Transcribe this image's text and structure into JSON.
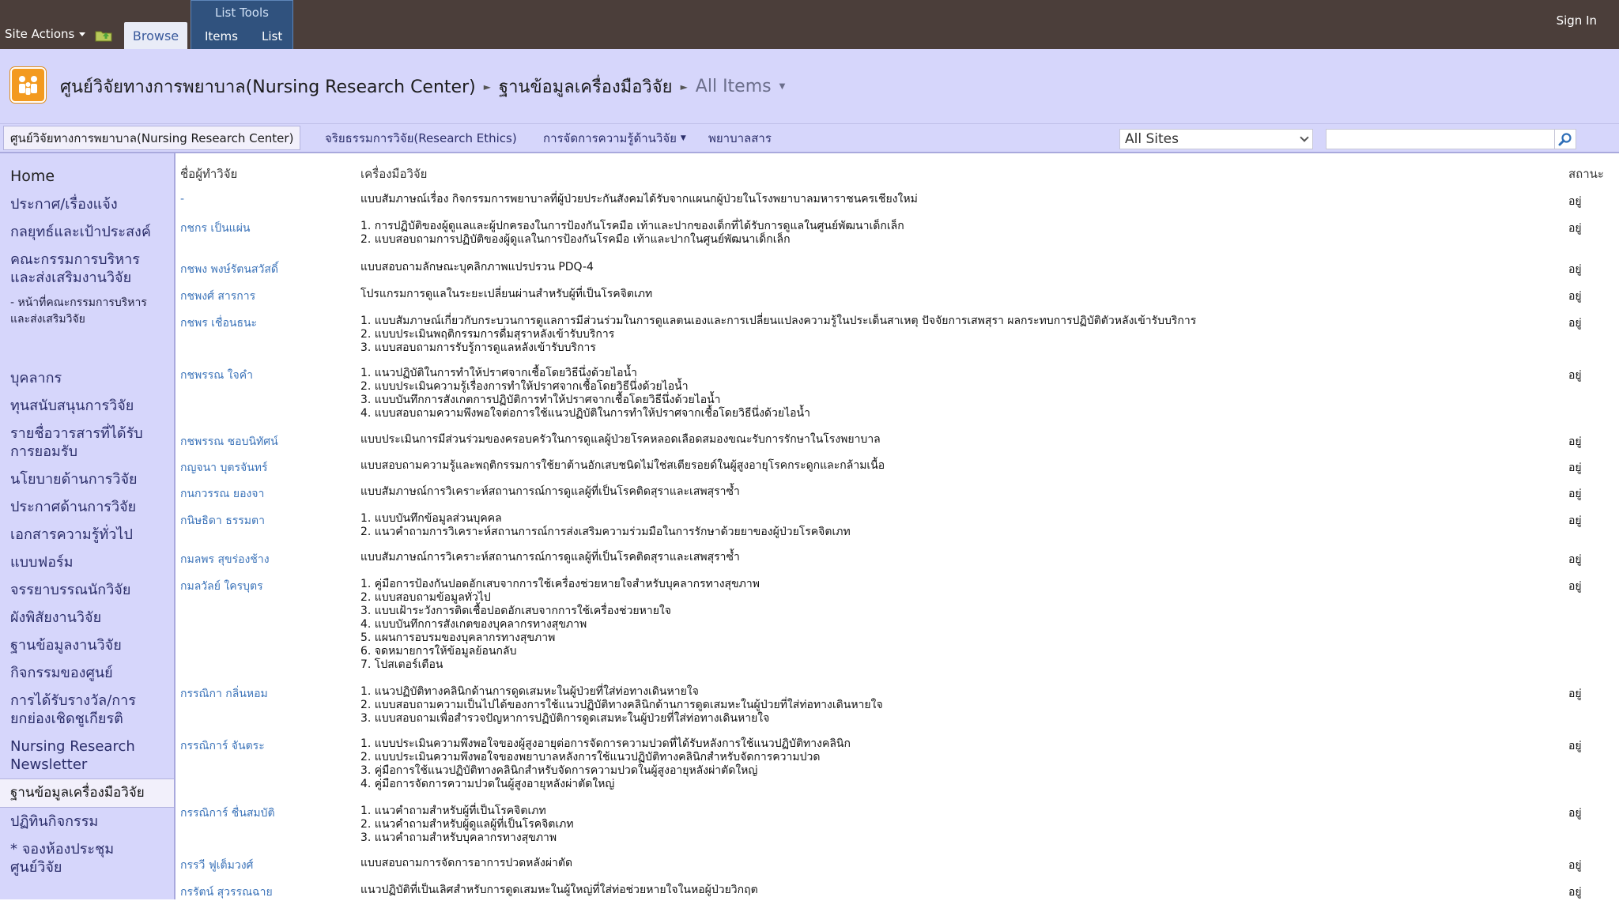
{
  "ribbon": {
    "site_actions": "Site Actions",
    "browse_tab": "Browse",
    "list_tools": "List Tools",
    "items_tab": "Items",
    "list_tab": "List",
    "sign_in": "Sign In"
  },
  "title": {
    "site": "ศูนย์วิจัยทางการพยาบาล(Nursing Research Center)",
    "list": "ฐานข้อมูลเครื่องมือวิจัย",
    "view": "All Items"
  },
  "topnav": {
    "items": [
      "ศูนย์วิจัยทางการพยาบาล(Nursing Research Center)",
      "จริยธรรมการวิจัย(Research Ethics)",
      "การจัดการความรู้ด้านวิจัย",
      "พยาบาลสาร"
    ],
    "scope": "All Sites"
  },
  "leftnav": {
    "items": [
      "Home",
      "ประกาศ/เรื่องแจ้ง",
      "กลยุทธ์และเป้าประสงค์",
      "คณะกรรมการบริหารและส่งเสริมงานวิจัย",
      "- หน้าที่คณะกรรมการบริหารและส่งเสริมวิจัย",
      "บุคลากร",
      "ทุนสนับสนุนการวิจัย",
      "รายชื่อวารสารที่ได้รับการยอมรับ",
      "นโยบายด้านการวิจัย",
      "ประกาศด้านการวิจัย",
      "เอกสารความรู้ทั่วไป",
      "แบบฟอร์ม",
      "จรรยาบรรณนักวิจัย",
      "ผังพิสัยงานวิจัย",
      "ฐานข้อมูลงานวิจัย",
      "กิจกรรมของศูนย์",
      "การได้รับรางวัล/การยกย่องเชิดชูเกียรติ",
      "Nursing Research Newsletter",
      "ฐานข้อมูลเครื่องมือวิจัย",
      "ปฏิทินกิจกรรม",
      "* จองห้องประชุมศูนย์วิจัย"
    ]
  },
  "table": {
    "headers": [
      "ชื่อผู้ทำวิจัย",
      "เครื่องมือวิจัย",
      "สถานะ"
    ],
    "rows": [
      {
        "name": "-",
        "tools": [
          "แบบสัมภาษณ์เรื่อง กิจกรรมการพยาบาลที่ผู้ป่วยประกันสังคมได้รับจากแผนกผู้ป่วยในโรงพยาบาลมหาราชนครเชียงใหม่"
        ],
        "status": "อยู่"
      },
      {
        "name": "กชกร เป็นแผ่น",
        "tools": [
          "1. การปฏิบัติของผู้ดูแลและผู้ปกครองในการป้องกันโรคมือ เท้าและปากของเด็กที่ได้รับการดูแลในศูนย์พัฒนาเด็กเล็ก",
          "2. แบบสอบถามการปฏิบัติของผู้ดูแลในการป้องกันโรคมือ เท้าและปากในศูนย์พัฒนาเด็กเล็ก"
        ],
        "status": "อยู่"
      },
      {
        "name": "กชพง พงษ์รัตนสวัสดิ์",
        "tools": [
          " แบบสอบถามลักษณะบุคลิกภาพแปรปรวน PDQ-4"
        ],
        "status": "อยู่"
      },
      {
        "name": "กชพงศ์ สารการ",
        "tools": [
          "โปรแกรมการดูแลในระยะเปลี่ยนผ่านสำหรับผู้ที่เป็นโรคจิตเภท"
        ],
        "status": "อยู่"
      },
      {
        "name": "กชพร เชื่อนธนะ",
        "tools": [
          "1. แบบสัมภาษณ์เกี่ยวกับกระบวนการดูแลการมีส่วนร่วมในการดูแลตนเองและการเปลี่ยนแปลงความรู้ในประเด็นสาเหตุ ปัจจัยการเสพสุรา ผลกระทบการปฏิบัติตัวหลังเข้ารับบริการ",
          "2. แบบประเมินพฤติกรรมการดื่มสุราหลังเข้ารับบริการ",
          "3. แบบสอบถามการรับรู้การดูแลหลังเข้ารับบริการ"
        ],
        "status": "อยู่"
      },
      {
        "name": "กชพรรณ ใจคำ",
        "tools": [
          "1. แนวปฏิบัติในการทำให้ปราศจากเชื้อโดยวิธีนึ่งด้วยไอน้ำ",
          "2. แบบประเมินความรู้เรื่องการทำให้ปราศจากเชื้อโดยวิธีนึ่งด้วยไอน้ำ",
          "3. แบบบันทึกการสังเกตการปฏิบัติการทำให้ปราศจากเชื้อโดยวิธีนึ่งด้วยไอน้ำ",
          "4. แบบสอบถามความพึงพอใจต่อการใช้แนวปฏิบัติในการทำให้ปราศจากเชื้อโดยวิธีนึ่งด้วยไอน้ำ"
        ],
        "status": "อยู่"
      },
      {
        "name": "กชพรรณ ชอบนิทัศน์",
        "tools": [
          "แบบประเมินการมีส่วนร่วมของครอบครัวในการดูแลผู้ป่วยโรคหลอดเลือดสมองขณะรับการรักษาในโรงพยาบาล"
        ],
        "status": "อยู่"
      },
      {
        "name": "กญจนา บุตรจันทร์",
        "tools": [
          "แบบสอบถามความรู้และพฤติกรรมการใช้ยาต้านอักเสบชนิดไม่ใช่สเตียรอยด์ในผู้สูงอายุโรคกระดูกและกล้ามเนื้อ"
        ],
        "status": "อยู่"
      },
      {
        "name": "กนกวรรณ ยองจา",
        "tools": [
          "แบบสัมภาษณ์การวิเคราะห์สถานการณ์การดูแลผู้ที่เป็นโรคติดสุราและเสพสุราซ้ำ"
        ],
        "status": "อยู่"
      },
      {
        "name": "กนิษธิดา ธรรมตา",
        "tools": [
          "1. แบบบันทึกข้อมูลส่วนบุคคล",
          "2. แนวคำถามการวิเคราะห์สถานการณ์การส่งเสริมความร่วมมือในการรักษาด้วยยาของผู้ป่วยโรคจิตเภท"
        ],
        "status": "อยู่"
      },
      {
        "name": "กมลพร สุขร่องช้าง",
        "tools": [
          "แบบสัมภาษณ์การวิเคราะห์สถานการณ์การดูแลผู้ที่เป็นโรคติดสุราและเสพสุราซ้ำ"
        ],
        "status": "อยู่"
      },
      {
        "name": "กมลวัลย์ ใครบุตร",
        "tools": [
          "1. คู่มือการป้องกันปอดอักเสบจากการใช้เครื่องช่วยหายใจสำหรับบุคลากรทางสุขภาพ",
          "2. แบบสอบถามข้อมูลทั่วไป",
          "3. แบบเฝ้าระวังการติดเชื้อปอดอักเสบจากการใช้เครื่องช่วยหายใจ",
          "4. แบบบันทึกการสังเกตของบุคลากรทางสุขภาพ",
          "5. แผนการอบรมของบุคลากรทางสุขภาพ",
          "6. จดหมายการให้ข้อมูลย้อนกลับ",
          "7. โปสเตอร์เตือน"
        ],
        "status": "อยู่"
      },
      {
        "name": "กรรณิกา กลิ่นหอม",
        "tools": [
          "1.  แนวปฏิบัติทางคลินิกด้านการดูดเสมหะในผู้ป่วยที่ใส่ท่อทางเดินหายใจ",
          "2.  แบบสอบถามความเป็นไปได้ของการใช้แนวปฏิบัติทางคลินิกด้านการดูดเสมหะในผู้ป่วยที่ใส่ท่อทางเดินหายใจ",
          "3.  แบบสอบถามเพื่อสำรวจปัญหาการปฏิบัติการดูดเสมหะในผู้ป่วยที่ใส่ท่อทางเดินหายใจ"
        ],
        "status": "อยู่"
      },
      {
        "name": "กรรณิการ์ จันตระ",
        "tools": [
          "1. แบบประเมินความพึงพอใจของผู้สูงอายุต่อการจัดการความปวดที่ได้รับหลังการใช้แนวปฏิบัติทางคลินิก",
          "2. แบบประเมินความพึงพอใจของพยาบาลหลังการใช้แนวปฏิบัติทางคลินิกสำหรับจัดการความปวด",
          "3. คู่มือการใช้แนวปฏิบัติทางคลินิกสำหรับจัดการความปวดในผู้สูงอายุหลังผ่าตัดใหญ่",
          "4. คู่มือการจัดการความปวดในผู้สูงอายุหลังผ่าตัดใหญ่"
        ],
        "status": "อยู่"
      },
      {
        "name": "กรรณิการ์ ชื่นสมบัติ",
        "tools": [
          "1. แนวคำถามสำหรับผู้ที่เป็นโรคจิตเภท",
          "2. แนวคำถามสำหรับผู้ดูแลผู้ที่เป็นโรคจิตเภท",
          "3. แนวคำถามสำหรับบุคลากรทางสุขภาพ"
        ],
        "status": "อยู่"
      },
      {
        "name": "กรรวี ฟูเต็มวงศ์",
        "tools": [
          "แบบสอบถามการจัดการอาการปวดหลังผ่าตัด"
        ],
        "status": "อยู่"
      },
      {
        "name": "กรรัตน์ สุวรรณฉาย",
        "tools": [
          "แนวปฏิบัติที่เป็นเลิศสำหรับการดูดเสมหะในผู้ใหญ่ที่ใส่ท่อช่วยหายใจในหอผู้ป่วยวิกฤต"
        ],
        "status": "อยู่"
      }
    ]
  }
}
